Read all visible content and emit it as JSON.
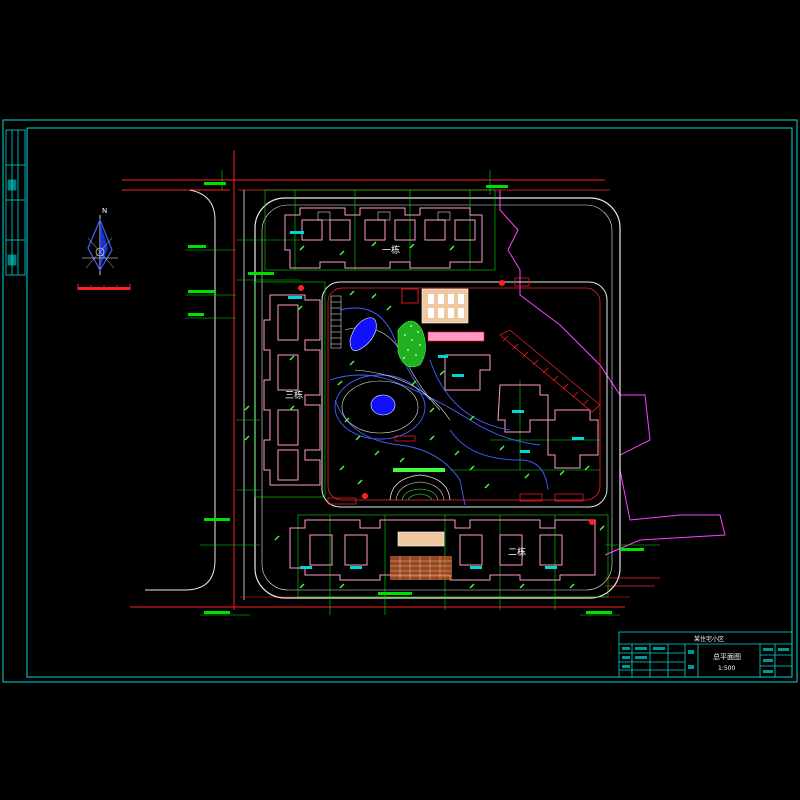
{
  "colors": {
    "background": "#000000",
    "frame": "#00d8d8",
    "road_red": "#ff2020",
    "green": "#00e000",
    "bright_green": "#40ff40",
    "building_outline": "#ff9ac8",
    "building_fill": "#f0c8a0",
    "road_white": "#e8e8e8",
    "magenta": "#ff40ff",
    "blue_water": "#1010ff",
    "yellow": "#ffff40",
    "cyan": "#00ffff",
    "orange": "#ff8040"
  },
  "north_arrow": {
    "label": "N"
  },
  "building_labels": {
    "north": "一栋",
    "west": "三栋",
    "south": "二栋"
  },
  "title_block": {
    "project_name": "某住宅小区",
    "title": "总平面图",
    "scale": "1:500"
  }
}
